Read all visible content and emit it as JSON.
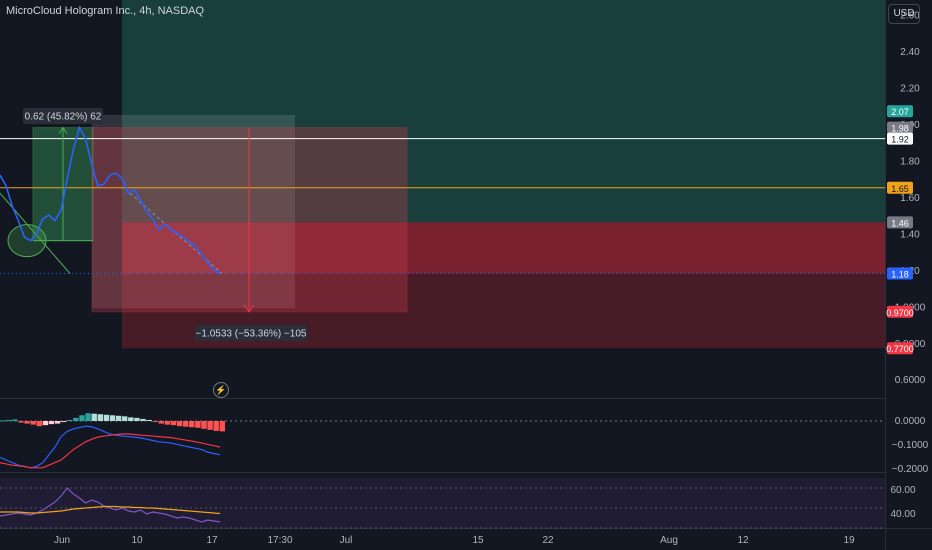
{
  "header": {
    "title": "MicroCloud Hologram Inc., 4h, NASDAQ",
    "currency_button": "USD"
  },
  "icons": {
    "bolt": "lightning-icon"
  },
  "price_axis": {
    "ticks": [
      "2.60",
      "2.40",
      "2.20",
      "2.00",
      "1.80",
      "1.60",
      "1.40",
      "1.20",
      "1.0000",
      "0.8000",
      "0.6000"
    ],
    "ylim": [
      0.53,
      2.68
    ]
  },
  "price_badges": [
    {
      "label": "2.07",
      "price": 2.07,
      "color": "#26a69a",
      "text": "#ffffff"
    },
    {
      "label": "1.98",
      "price": 1.98,
      "color": "#787b86",
      "text": "#ffffff"
    },
    {
      "label": "1.92",
      "price": 1.92,
      "color": "#ffffff",
      "text": "#131722"
    },
    {
      "label": "1.65",
      "price": 1.65,
      "color": "#f0a21b",
      "text": "#131722"
    },
    {
      "label": "1.46",
      "price": 1.46,
      "color": "#787b86",
      "text": "#ffffff"
    },
    {
      "label": "1.18",
      "price": 1.18,
      "color": "#2962ff",
      "text": "#ffffff"
    },
    {
      "label": "0.9700",
      "price": 0.97,
      "color": "#f23645",
      "text": "#ffffff"
    },
    {
      "label": "0.7700",
      "price": 0.77,
      "color": "#f23645",
      "text": "#ffffff"
    }
  ],
  "horizontal_lines": [
    {
      "price": 1.92,
      "color": "#ffffff"
    },
    {
      "price": 1.65,
      "color": "#f0a21b"
    }
  ],
  "measure_labels": {
    "up": "0.62 (45.82%) 62",
    "down": "−1.0533 (−53.36%) −105"
  },
  "macd_axis": {
    "ticks": [
      "0.0000",
      "−0.1000",
      "−0.2000"
    ]
  },
  "rsi_axis": {
    "ticks": [
      "60.00",
      "40.00"
    ]
  },
  "time_axis": {
    "labels": [
      "Jun",
      "10",
      "17",
      "17:30",
      "Jul",
      "15",
      "22",
      "Aug",
      "12",
      "19"
    ]
  },
  "chart_data": {
    "type": "line",
    "title": "MicroCloud Hologram Inc., 4h, NASDAQ",
    "price_series": [
      1.72,
      1.66,
      1.55,
      1.47,
      1.38,
      1.36,
      1.4,
      1.48,
      1.5,
      1.47,
      1.53,
      1.7,
      1.86,
      1.98,
      1.92,
      1.78,
      1.66,
      1.67,
      1.72,
      1.73,
      1.7,
      1.62,
      1.64,
      1.58,
      1.52,
      1.48,
      1.42,
      1.45,
      1.42,
      1.4,
      1.38,
      1.35,
      1.33,
      1.28,
      1.24,
      1.2,
      1.18
    ],
    "macd_histogram": [
      0.002,
      0.004,
      0.006,
      -0.006,
      -0.01,
      -0.014,
      -0.02,
      -0.016,
      -0.012,
      -0.01,
      -0.004,
      0.004,
      0.012,
      0.022,
      0.03,
      0.028,
      0.026,
      0.024,
      0.022,
      0.02,
      0.018,
      0.014,
      0.012,
      0.008,
      0.004,
      -0.004,
      -0.01,
      -0.014,
      -0.016,
      -0.02,
      -0.022,
      -0.024,
      -0.026,
      -0.03,
      -0.034,
      -0.038,
      -0.04
    ],
    "macd_line": [
      -0.14,
      -0.15,
      -0.16,
      -0.17,
      -0.175,
      -0.18,
      -0.175,
      -0.16,
      -0.13,
      -0.1,
      -0.06,
      -0.04,
      -0.03,
      -0.025,
      -0.02,
      -0.022,
      -0.03,
      -0.04,
      -0.05,
      -0.055,
      -0.058,
      -0.06,
      -0.062,
      -0.065,
      -0.07,
      -0.075,
      -0.08,
      -0.082,
      -0.085,
      -0.09,
      -0.095,
      -0.1,
      -0.105,
      -0.11,
      -0.12,
      -0.125,
      -0.13
    ],
    "signal_line": [
      -0.16,
      -0.165,
      -0.17,
      -0.172,
      -0.175,
      -0.18,
      -0.18,
      -0.18,
      -0.17,
      -0.16,
      -0.15,
      -0.13,
      -0.11,
      -0.095,
      -0.08,
      -0.07,
      -0.062,
      -0.058,
      -0.055,
      -0.052,
      -0.05,
      -0.05,
      -0.052,
      -0.054,
      -0.056,
      -0.058,
      -0.06,
      -0.062,
      -0.064,
      -0.068,
      -0.072,
      -0.076,
      -0.08,
      -0.085,
      -0.09,
      -0.095,
      -0.1
    ],
    "rsi": [
      42,
      43,
      44,
      45,
      44,
      43,
      45,
      48,
      52,
      56,
      62,
      70,
      64,
      60,
      55,
      58,
      56,
      52,
      50,
      48,
      50,
      47,
      46,
      48,
      44,
      46,
      45,
      44,
      42,
      40,
      41,
      40,
      38,
      36,
      38,
      37,
      36
    ],
    "rsi_ma": [
      46,
      46,
      46,
      46,
      45.5,
      45,
      45,
      45.5,
      46,
      46.5,
      47,
      48,
      49,
      49.5,
      50,
      50.5,
      51,
      51.5,
      51.5,
      51.5,
      51,
      51,
      50.5,
      50.5,
      50,
      50,
      49.5,
      49,
      48.5,
      48,
      47.5,
      47,
      46.5,
      46,
      45.5,
      45,
      44.5
    ],
    "time_labels": [
      "Jun",
      "10",
      "17",
      "17:30",
      "Jul",
      "15",
      "22",
      "Aug",
      "12",
      "19"
    ],
    "currency": "USD"
  }
}
